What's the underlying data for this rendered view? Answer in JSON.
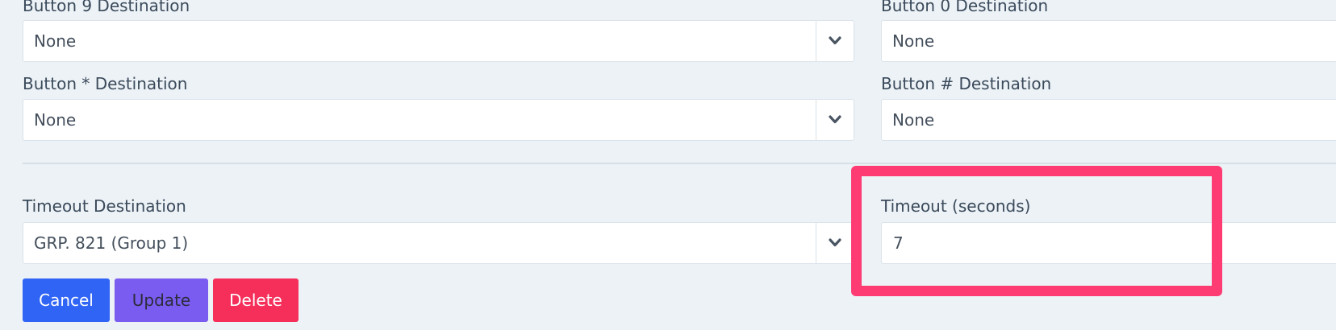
{
  "fields": {
    "button9": {
      "label": "Button 9 Destination",
      "value": "None"
    },
    "button0": {
      "label": "Button 0 Destination",
      "value": "None"
    },
    "buttonStar": {
      "label": "Button * Destination",
      "value": "None"
    },
    "buttonHash": {
      "label": "Button # Destination",
      "value": "None"
    },
    "timeoutDestination": {
      "label": "Timeout Destination",
      "value": "GRP. 821 (Group 1)"
    },
    "timeoutSeconds": {
      "label": "Timeout (seconds)",
      "value": "7"
    }
  },
  "actions": {
    "cancel": "Cancel",
    "update": "Update",
    "delete": "Delete"
  },
  "colors": {
    "background": "#ecf2f6",
    "cancel": "#2f64f5",
    "update": "#7a5cf0",
    "delete": "#f52e5a",
    "highlight": "#ff3b74"
  },
  "icons": {
    "select_arrow": "chevron-down-icon"
  }
}
